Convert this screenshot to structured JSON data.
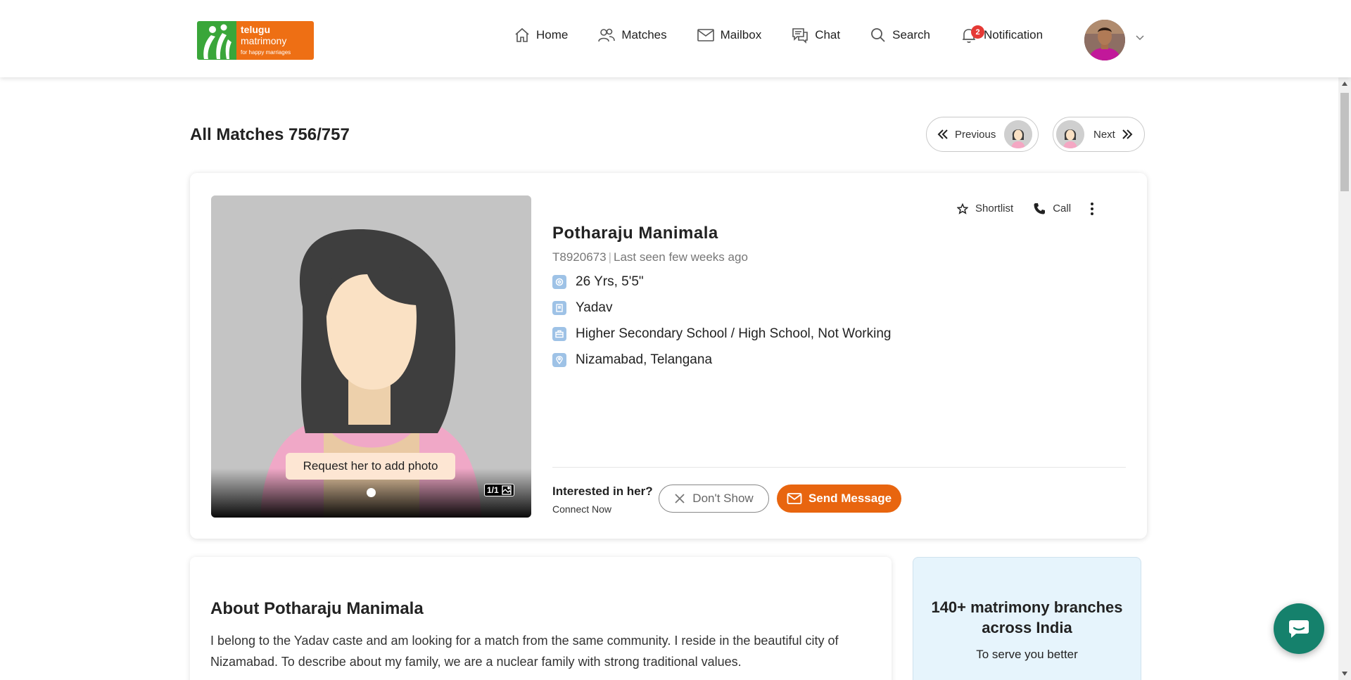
{
  "logo": {
    "line1": "telugu",
    "line2": "matrimony",
    "tagline": "for happy marriages"
  },
  "nav": {
    "home": "Home",
    "matches": "Matches",
    "mailbox": "Mailbox",
    "chat": "Chat",
    "search": "Search",
    "notification": "Notification",
    "notification_count": "2"
  },
  "title_row": {
    "title": "All Matches 756/757",
    "previous": "Previous",
    "next": "Next"
  },
  "profile": {
    "name": "Potharaju Manimala",
    "id": "T8920673",
    "last_seen": "Last seen few weeks ago",
    "age_height": "26 Yrs, 5'5\"",
    "caste": "Yadav",
    "education": "Higher Secondary School / High School, Not Working",
    "location": "Nizamabad, Telangana",
    "photo_request": "Request her to add photo",
    "photo_count": "1/1",
    "shortlist": "Shortlist",
    "call": "Call",
    "interested": "Interested in her?",
    "connect": "Connect Now",
    "dont_show": "Don't Show",
    "send_message": "Send Message"
  },
  "about": {
    "title": "About Potharaju Manimala",
    "text": "I belong to the Yadav caste and am looking for a match from the same community. I reside in the beautiful city of Nizamabad. To describe about my family, we are a nuclear family with strong traditional values."
  },
  "branch": {
    "title": "140+ matrimony branches across India",
    "subtitle": "To serve you better"
  },
  "colors": {
    "accent": "#e8650f",
    "brand_green": "#3aa63a",
    "chat_fab": "#15816c",
    "badge": "#e53935"
  }
}
